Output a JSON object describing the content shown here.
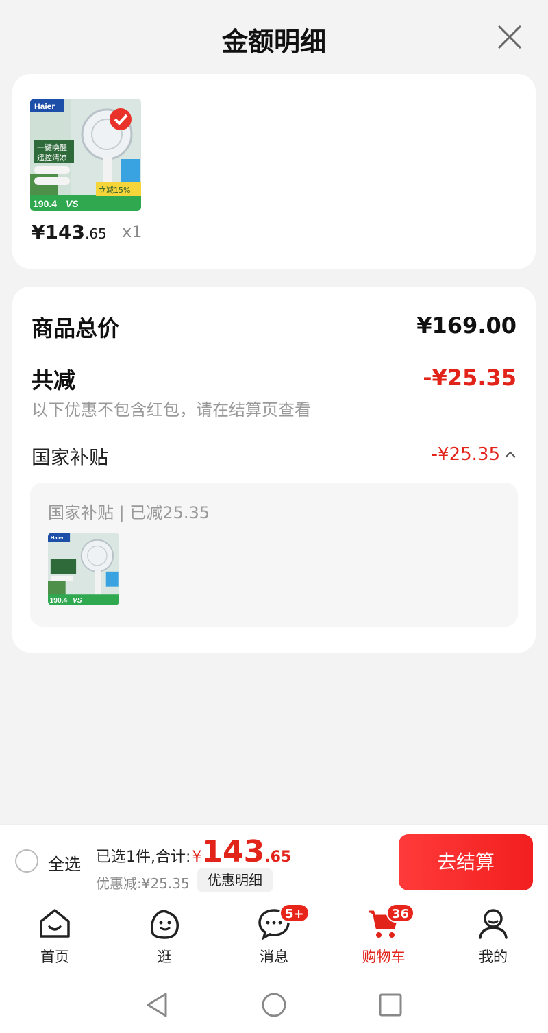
{
  "header": {
    "title": "金额明细",
    "close_icon": "close-icon"
  },
  "product": {
    "price_int": "¥143",
    "price_dec": ".65",
    "quantity": "x1",
    "thumb": {
      "brand": "Haier",
      "line1": "一键唤醒",
      "line2": "遥控清凉",
      "price_tag": "190.4",
      "vs": "VS",
      "promo": "立减15%"
    }
  },
  "summary": {
    "total_label": "商品总价",
    "total_value": "¥169.00",
    "reduce_label": "共减",
    "reduce_value": "-¥25.35",
    "note": "以下优惠不包含红包，请在结算页查看",
    "subsidy_label": "国家补贴",
    "subsidy_value": "-¥25.35",
    "subsidy_chevron": "^",
    "detail_title": "国家补贴 | 已减25.35"
  },
  "checkout": {
    "select_all": "全选",
    "selected_text": "已选1件,合计:",
    "currency": "¥",
    "total_int": "143",
    "total_dec": ".65",
    "discount_text": "优惠减:¥25.35",
    "detail_button": "优惠明细",
    "pay_button": "去结算"
  },
  "tabs": [
    {
      "label": "首页",
      "icon": "home-icon"
    },
    {
      "label": "逛",
      "icon": "browse-icon"
    },
    {
      "label": "消息",
      "icon": "message-icon",
      "badge": "5+"
    },
    {
      "label": "购物车",
      "icon": "cart-icon",
      "badge": "36",
      "active": true
    },
    {
      "label": "我的",
      "icon": "profile-icon"
    }
  ],
  "colors": {
    "accent": "#e2231a",
    "background": "#f3f3f3"
  }
}
